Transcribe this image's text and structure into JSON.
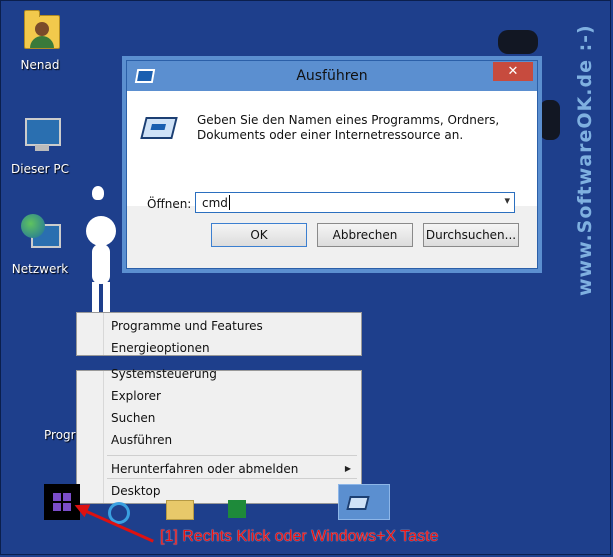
{
  "desktop": {
    "icons": [
      {
        "label": "Nenad",
        "icon": "user-folder-icon"
      },
      {
        "label": "Dieser PC",
        "icon": "computer-icon"
      },
      {
        "label": "Netzwerk",
        "icon": "network-icon"
      },
      {
        "label": "Progr",
        "icon": "program-icon"
      }
    ]
  },
  "dialog": {
    "title": "Ausführen",
    "close_label": "✕",
    "description": "Geben Sie den Namen eines Programms, Ordners, Dokuments oder einer Internetressource an.",
    "open_label": "Öffnen:",
    "open_value": "cmd",
    "ok_label": "OK",
    "cancel_label": "Abbrechen",
    "browse_label": "Durchsuchen..."
  },
  "context_menu": {
    "top_items": [
      "Programme und Features",
      "Energieoptionen"
    ],
    "items": [
      "Systemsteuerung",
      "Explorer",
      "Suchen",
      "Ausführen"
    ],
    "shutdown_label": "Herunterfahren oder abmelden",
    "desktop_label": "Desktop"
  },
  "annotation": "[1] Rechts Klick oder Windows+X Taste",
  "watermark": "www.SoftwareOK.de :-)",
  "colors": {
    "desktop_bg": "#1e3f8c",
    "titlebar": "#5b8fd0",
    "close_button": "#c74b3e",
    "annotation": "#e11111"
  }
}
